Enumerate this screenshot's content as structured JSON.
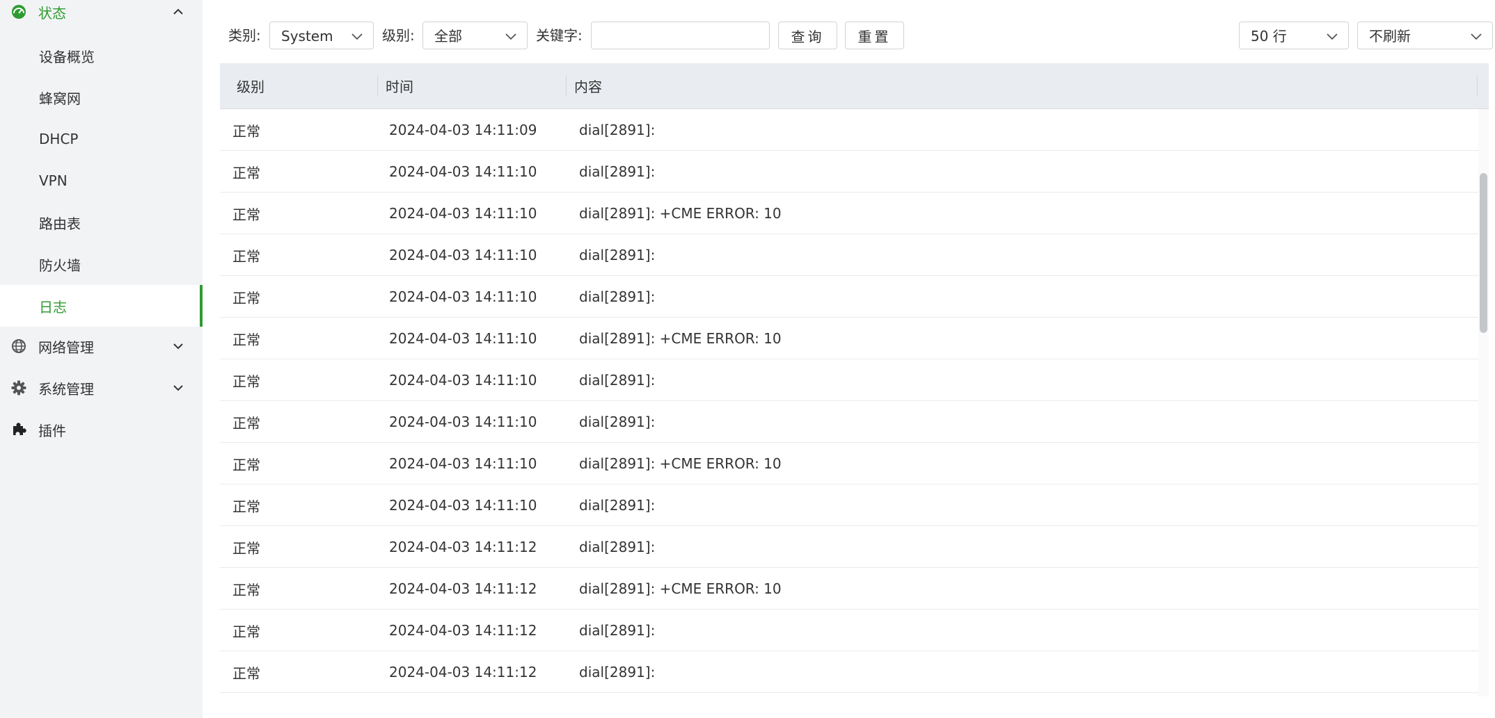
{
  "sidebar": {
    "status": {
      "label": "状态",
      "icon": "dashboard-icon"
    },
    "sub_items": [
      {
        "label": "设备概览"
      },
      {
        "label": "蜂窝网"
      },
      {
        "label": "DHCP"
      },
      {
        "label": "VPN"
      },
      {
        "label": "路由表"
      },
      {
        "label": "防火墙"
      },
      {
        "label": "日志",
        "active": true
      }
    ],
    "network": {
      "label": "网络管理",
      "icon": "globe-icon"
    },
    "system": {
      "label": "系统管理",
      "icon": "gear-icon"
    },
    "plugins": {
      "label": "插件",
      "icon": "puzzle-icon"
    }
  },
  "toolbar": {
    "category_label": "类别:",
    "category_value": "System",
    "level_label": "级别:",
    "level_value": "全部",
    "keyword_label": "关键字:",
    "keyword_value": "",
    "query_button": "查询",
    "reset_button": "重置",
    "rows_value": "50 行",
    "refresh_value": "不刷新"
  },
  "table": {
    "columns": [
      "级别",
      "时间",
      "内容"
    ],
    "rows": [
      {
        "level": "正常",
        "time": "2024-04-03 14:11:09",
        "content": "dial[2891]:"
      },
      {
        "level": "正常",
        "time": "2024-04-03 14:11:10",
        "content": "dial[2891]:"
      },
      {
        "level": "正常",
        "time": "2024-04-03 14:11:10",
        "content": "dial[2891]: +CME ERROR: 10"
      },
      {
        "level": "正常",
        "time": "2024-04-03 14:11:10",
        "content": "dial[2891]:"
      },
      {
        "level": "正常",
        "time": "2024-04-03 14:11:10",
        "content": "dial[2891]:"
      },
      {
        "level": "正常",
        "time": "2024-04-03 14:11:10",
        "content": "dial[2891]: +CME ERROR: 10"
      },
      {
        "level": "正常",
        "time": "2024-04-03 14:11:10",
        "content": "dial[2891]:"
      },
      {
        "level": "正常",
        "time": "2024-04-03 14:11:10",
        "content": "dial[2891]:"
      },
      {
        "level": "正常",
        "time": "2024-04-03 14:11:10",
        "content": "dial[2891]: +CME ERROR: 10"
      },
      {
        "level": "正常",
        "time": "2024-04-03 14:11:10",
        "content": "dial[2891]:"
      },
      {
        "level": "正常",
        "time": "2024-04-03 14:11:12",
        "content": "dial[2891]:"
      },
      {
        "level": "正常",
        "time": "2024-04-03 14:11:12",
        "content": "dial[2891]: +CME ERROR: 10"
      },
      {
        "level": "正常",
        "time": "2024-04-03 14:11:12",
        "content": "dial[2891]:"
      },
      {
        "level": "正常",
        "time": "2024-04-03 14:11:12",
        "content": "dial[2891]:"
      }
    ]
  },
  "colors": {
    "accent": "#2e9b30",
    "sidebar_bg": "#f2f3f5",
    "header_bg": "#e9edf1"
  }
}
